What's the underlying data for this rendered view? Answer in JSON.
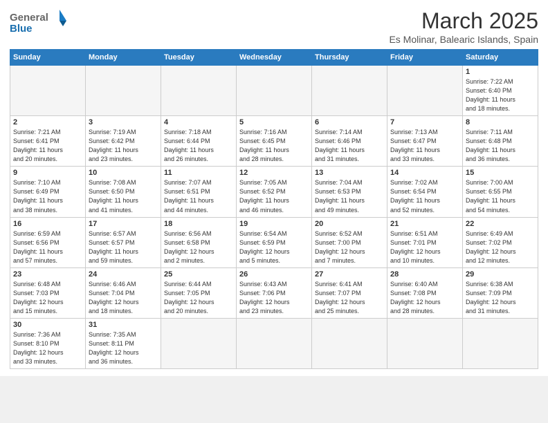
{
  "header": {
    "logo_general": "General",
    "logo_blue": "Blue",
    "month_title": "March 2025",
    "location": "Es Molinar, Balearic Islands, Spain"
  },
  "weekdays": [
    "Sunday",
    "Monday",
    "Tuesday",
    "Wednesday",
    "Thursday",
    "Friday",
    "Saturday"
  ],
  "weeks": [
    [
      {
        "day": "",
        "info": ""
      },
      {
        "day": "",
        "info": ""
      },
      {
        "day": "",
        "info": ""
      },
      {
        "day": "",
        "info": ""
      },
      {
        "day": "",
        "info": ""
      },
      {
        "day": "",
        "info": ""
      },
      {
        "day": "1",
        "info": "Sunrise: 7:22 AM\nSunset: 6:40 PM\nDaylight: 11 hours\nand 18 minutes."
      }
    ],
    [
      {
        "day": "2",
        "info": "Sunrise: 7:21 AM\nSunset: 6:41 PM\nDaylight: 11 hours\nand 20 minutes."
      },
      {
        "day": "3",
        "info": "Sunrise: 7:19 AM\nSunset: 6:42 PM\nDaylight: 11 hours\nand 23 minutes."
      },
      {
        "day": "4",
        "info": "Sunrise: 7:18 AM\nSunset: 6:44 PM\nDaylight: 11 hours\nand 26 minutes."
      },
      {
        "day": "5",
        "info": "Sunrise: 7:16 AM\nSunset: 6:45 PM\nDaylight: 11 hours\nand 28 minutes."
      },
      {
        "day": "6",
        "info": "Sunrise: 7:14 AM\nSunset: 6:46 PM\nDaylight: 11 hours\nand 31 minutes."
      },
      {
        "day": "7",
        "info": "Sunrise: 7:13 AM\nSunset: 6:47 PM\nDaylight: 11 hours\nand 33 minutes."
      },
      {
        "day": "8",
        "info": "Sunrise: 7:11 AM\nSunset: 6:48 PM\nDaylight: 11 hours\nand 36 minutes."
      }
    ],
    [
      {
        "day": "9",
        "info": "Sunrise: 7:10 AM\nSunset: 6:49 PM\nDaylight: 11 hours\nand 38 minutes."
      },
      {
        "day": "10",
        "info": "Sunrise: 7:08 AM\nSunset: 6:50 PM\nDaylight: 11 hours\nand 41 minutes."
      },
      {
        "day": "11",
        "info": "Sunrise: 7:07 AM\nSunset: 6:51 PM\nDaylight: 11 hours\nand 44 minutes."
      },
      {
        "day": "12",
        "info": "Sunrise: 7:05 AM\nSunset: 6:52 PM\nDaylight: 11 hours\nand 46 minutes."
      },
      {
        "day": "13",
        "info": "Sunrise: 7:04 AM\nSunset: 6:53 PM\nDaylight: 11 hours\nand 49 minutes."
      },
      {
        "day": "14",
        "info": "Sunrise: 7:02 AM\nSunset: 6:54 PM\nDaylight: 11 hours\nand 52 minutes."
      },
      {
        "day": "15",
        "info": "Sunrise: 7:00 AM\nSunset: 6:55 PM\nDaylight: 11 hours\nand 54 minutes."
      }
    ],
    [
      {
        "day": "16",
        "info": "Sunrise: 6:59 AM\nSunset: 6:56 PM\nDaylight: 11 hours\nand 57 minutes."
      },
      {
        "day": "17",
        "info": "Sunrise: 6:57 AM\nSunset: 6:57 PM\nDaylight: 11 hours\nand 59 minutes."
      },
      {
        "day": "18",
        "info": "Sunrise: 6:56 AM\nSunset: 6:58 PM\nDaylight: 12 hours\nand 2 minutes."
      },
      {
        "day": "19",
        "info": "Sunrise: 6:54 AM\nSunset: 6:59 PM\nDaylight: 12 hours\nand 5 minutes."
      },
      {
        "day": "20",
        "info": "Sunrise: 6:52 AM\nSunset: 7:00 PM\nDaylight: 12 hours\nand 7 minutes."
      },
      {
        "day": "21",
        "info": "Sunrise: 6:51 AM\nSunset: 7:01 PM\nDaylight: 12 hours\nand 10 minutes."
      },
      {
        "day": "22",
        "info": "Sunrise: 6:49 AM\nSunset: 7:02 PM\nDaylight: 12 hours\nand 12 minutes."
      }
    ],
    [
      {
        "day": "23",
        "info": "Sunrise: 6:48 AM\nSunset: 7:03 PM\nDaylight: 12 hours\nand 15 minutes."
      },
      {
        "day": "24",
        "info": "Sunrise: 6:46 AM\nSunset: 7:04 PM\nDaylight: 12 hours\nand 18 minutes."
      },
      {
        "day": "25",
        "info": "Sunrise: 6:44 AM\nSunset: 7:05 PM\nDaylight: 12 hours\nand 20 minutes."
      },
      {
        "day": "26",
        "info": "Sunrise: 6:43 AM\nSunset: 7:06 PM\nDaylight: 12 hours\nand 23 minutes."
      },
      {
        "day": "27",
        "info": "Sunrise: 6:41 AM\nSunset: 7:07 PM\nDaylight: 12 hours\nand 25 minutes."
      },
      {
        "day": "28",
        "info": "Sunrise: 6:40 AM\nSunset: 7:08 PM\nDaylight: 12 hours\nand 28 minutes."
      },
      {
        "day": "29",
        "info": "Sunrise: 6:38 AM\nSunset: 7:09 PM\nDaylight: 12 hours\nand 31 minutes."
      }
    ],
    [
      {
        "day": "30",
        "info": "Sunrise: 7:36 AM\nSunset: 8:10 PM\nDaylight: 12 hours\nand 33 minutes."
      },
      {
        "day": "31",
        "info": "Sunrise: 7:35 AM\nSunset: 8:11 PM\nDaylight: 12 hours\nand 36 minutes."
      },
      {
        "day": "",
        "info": ""
      },
      {
        "day": "",
        "info": ""
      },
      {
        "day": "",
        "info": ""
      },
      {
        "day": "",
        "info": ""
      },
      {
        "day": "",
        "info": ""
      }
    ]
  ]
}
